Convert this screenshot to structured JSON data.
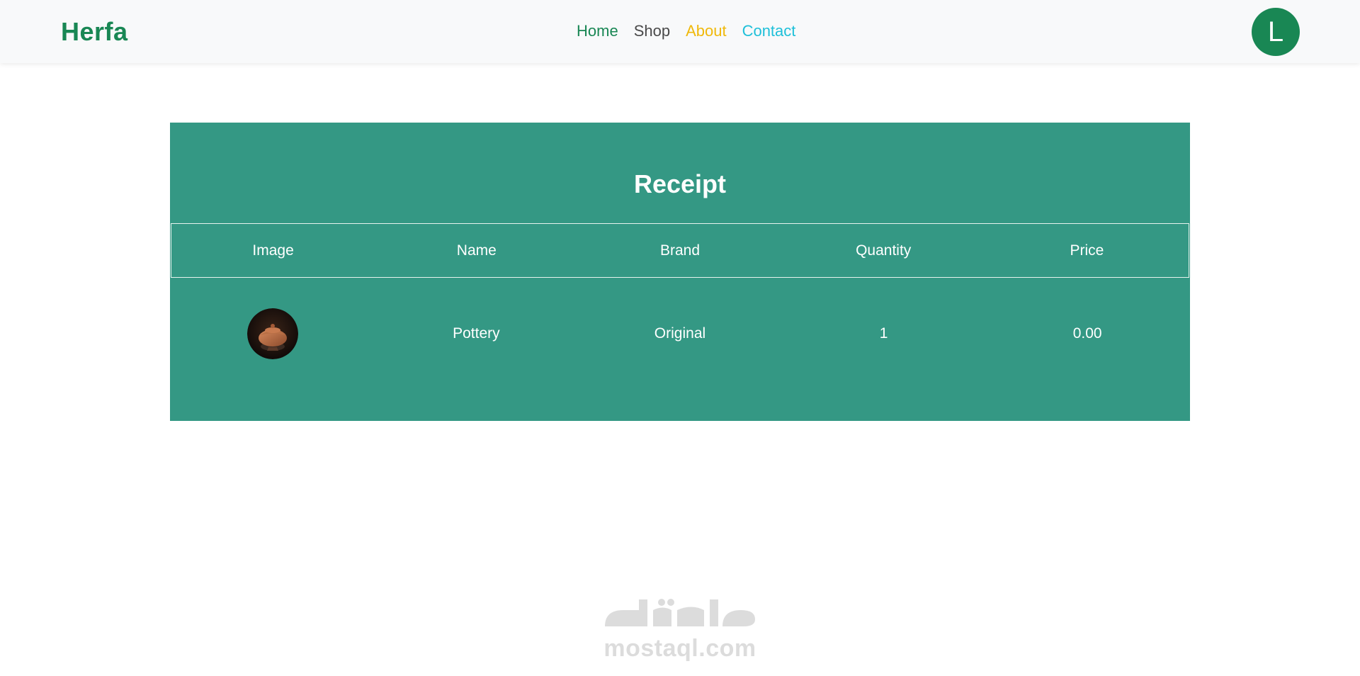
{
  "nav": {
    "brand": "Herfa",
    "links": [
      {
        "label": "Home",
        "color": "#198754"
      },
      {
        "label": "Shop",
        "color": "#4a4a4a"
      },
      {
        "label": "About",
        "color": "#f0b90b"
      },
      {
        "label": "Contact",
        "color": "#1fc0d9"
      }
    ],
    "avatar_initial": "L"
  },
  "receipt": {
    "title": "Receipt",
    "columns": [
      "Image",
      "Name",
      "Brand",
      "Quantity",
      "Price"
    ],
    "rows": [
      {
        "image_icon": "pottery-pot-image",
        "name": "Pottery",
        "brand": "Original",
        "quantity": "1",
        "price": "0.00"
      }
    ]
  },
  "watermark": {
    "arabic_logo_text": "مستقل",
    "domain": "mostaql.com"
  },
  "colors": {
    "brand": "#198754",
    "receipt_background": "#349884",
    "navbar_background": "#f8f9fa"
  }
}
